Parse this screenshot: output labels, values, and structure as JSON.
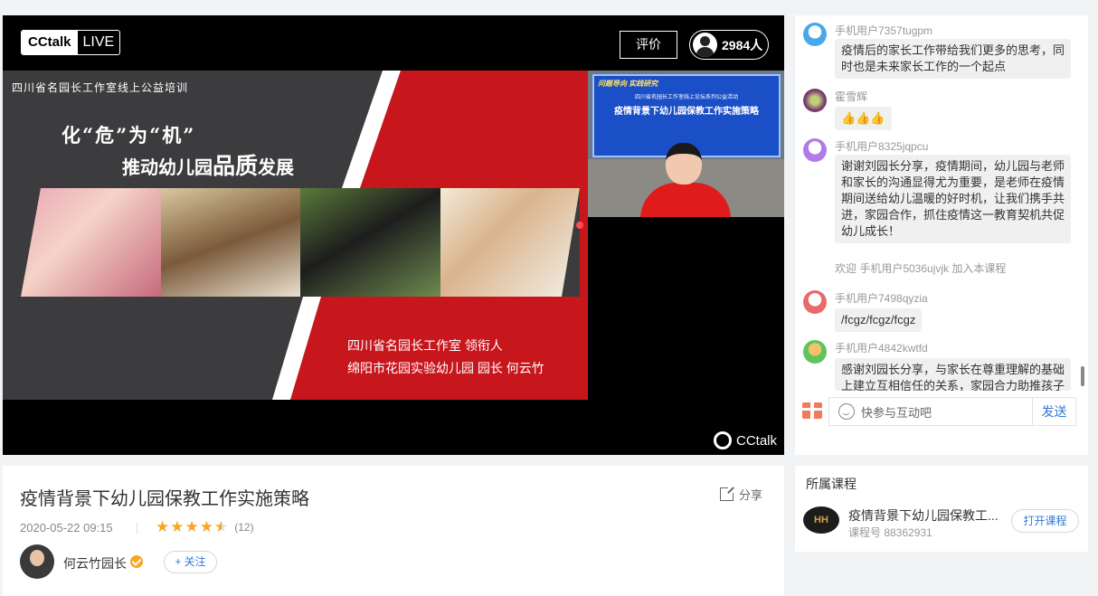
{
  "player": {
    "logo_cc": "CCtalk",
    "logo_live": "LIVE",
    "rate_label": "评价",
    "viewer_count": "2984人",
    "watermark": "CCtalk",
    "slide": {
      "top_line": "四川省名园长工作室线上公益培训",
      "title_line1": "化“危”为“机”",
      "title_line2_pre": "推动幼儿园",
      "title_line2_bold": "品质",
      "title_line2_post": "发展",
      "caption1": "四川省名园长工作室 领衔人",
      "caption2": "绵阳市花园实验幼儿园 园长   何云竹"
    },
    "camera_screen": {
      "line1": "问题导向  实践研究",
      "line2": "四川省名园长工作室线上论坛系列公益活动",
      "line3": "疫情背景下幼儿园保教工作实施策略"
    }
  },
  "chat": {
    "messages": [
      {
        "name": "手机用户7357tugpm",
        "text": [
          "疫情后的家长工作带给我们更多的思考，同",
          "时也是未来家长工作的一个起点"
        ]
      },
      {
        "name": "霍雪辉",
        "text": [
          "👍👍👍"
        ]
      },
      {
        "name": "手机用户8325jqpcu",
        "text": [
          "谢谢刘园长分享，疫情期间，幼儿园与老师",
          "和家长的沟通显得尤为重要，是老师在疫情",
          "期间送给幼儿温暖的好时机，让我们携手共",
          "进，家园合作，抓住疫情这一教育契机共促",
          "幼儿成长！"
        ]
      },
      {
        "name": "手机用户7498qyzia",
        "text": [
          "/fcgz/fcgz/fcgz"
        ]
      },
      {
        "name": "手机用户4842kwtfd",
        "text": [
          "感谢刘园长分享，与家长在尊重理解的基础",
          "上建立互相信任的关系，家园合力助推孩子"
        ]
      }
    ],
    "system_notice": "欢迎 手机用户5036ujvjk 加入本课程",
    "input_placeholder": "快参与互动吧",
    "send_label": "发送"
  },
  "course": {
    "title": "疫情背景下幼儿园保教工作实施策略",
    "share_label": "分享",
    "date": "2020-05-22 09:15",
    "rating": 4.5,
    "rating_count": "(12)",
    "teacher_name": "何云竹园长",
    "follow_label": "+ 关注"
  },
  "related": {
    "label": "所属课程",
    "course_name": "疫情背景下幼儿园保教工...",
    "course_no": "课程号 88362931",
    "open_label": "打开课程",
    "thumb_text": "HH"
  },
  "colors": {
    "accent_blue": "#2f7ad6",
    "slide_red": "#c8161d",
    "star_orange": "#f5a623"
  }
}
